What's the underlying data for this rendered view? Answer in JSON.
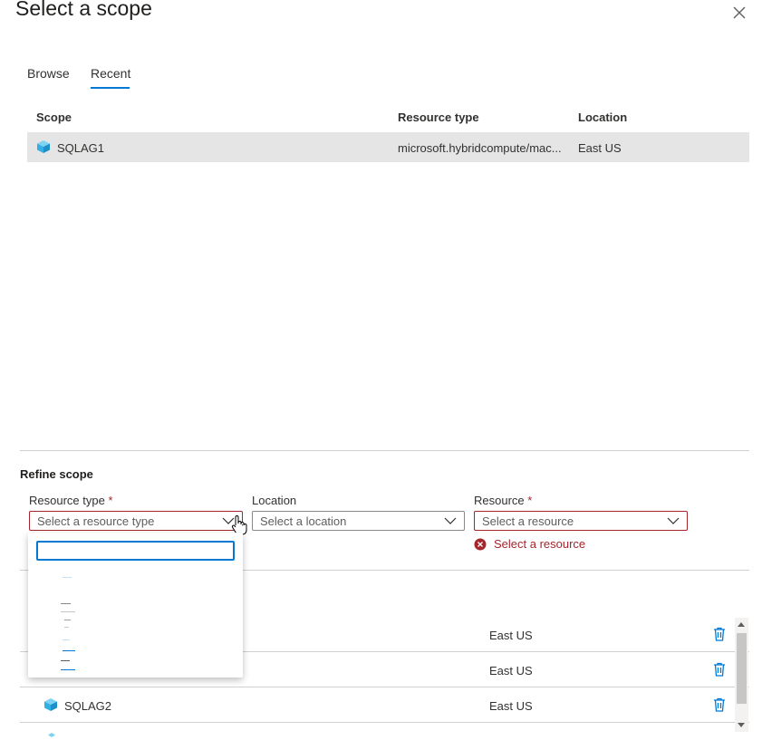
{
  "dialog": {
    "title": "Select a scope"
  },
  "tabs": [
    {
      "label": "Browse"
    },
    {
      "label": "Recent",
      "active": true
    }
  ],
  "recent_table": {
    "headers": {
      "scope": "Scope",
      "resource_type": "Resource type",
      "location": "Location"
    },
    "rows": [
      {
        "scope": "SQLAG1",
        "resource_type": "microsoft.hybridcompute/mac...",
        "location": "East US",
        "icon": "cube-icon",
        "selected": true
      }
    ]
  },
  "refine": {
    "title": "Refine scope",
    "resource_type": {
      "label": "Resource type",
      "required": "*",
      "placeholder": "Select a resource type"
    },
    "location": {
      "label": "Location",
      "placeholder": "Select a location"
    },
    "resource": {
      "label": "Resource",
      "required": "*",
      "placeholder": "Select a resource",
      "error": "Select a resource"
    }
  },
  "selected_list": {
    "rows": [
      {
        "name": "",
        "location": "East US"
      },
      {
        "name": "",
        "location": "East US"
      },
      {
        "name": "SQLAG2",
        "location": "East US"
      }
    ]
  },
  "colors": {
    "accent": "#0078d4",
    "error": "#a4262c",
    "selected_row": "#e5e5e5",
    "trash": "#0078d4"
  }
}
